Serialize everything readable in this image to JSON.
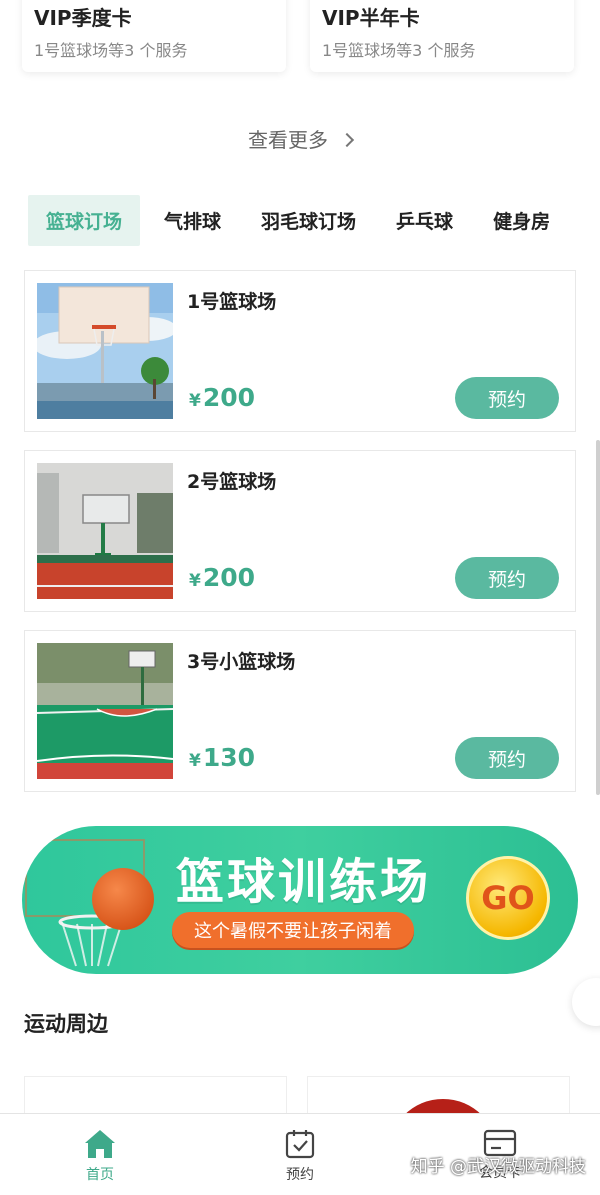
{
  "vip_cards": [
    {
      "title": "VIP季度卡",
      "subtitle": "1号篮球场等3 个服务"
    },
    {
      "title": "VIP半年卡",
      "subtitle": "1号篮球场等3 个服务"
    }
  ],
  "more_label": "查看更多",
  "tabs": [
    "篮球订场",
    "气排球",
    "羽毛球订场",
    "乒乓球",
    "健身房"
  ],
  "venues": [
    {
      "name": "1号篮球场",
      "currency": "¥",
      "price": "200",
      "book_label": "预约"
    },
    {
      "name": "2号篮球场",
      "currency": "¥",
      "price": "200",
      "book_label": "预约"
    },
    {
      "name": "3号小篮球场",
      "currency": "¥",
      "price": "130",
      "book_label": "预约"
    }
  ],
  "banner": {
    "title": "篮球训练场",
    "subtitle": "这个暑假不要让孩子闲着",
    "go_label": "GO"
  },
  "section_title": "运动周边",
  "nav": [
    {
      "label": "首页",
      "icon": "home-icon"
    },
    {
      "label": "预约",
      "icon": "calendar-check-icon"
    },
    {
      "label": "会员卡",
      "icon": "card-icon"
    }
  ],
  "watermark": "知乎 @武汉微驱动科技",
  "colors": {
    "accent": "#3ea98a",
    "button": "#5ab9a0",
    "tab_active_bg": "#e6f3ef",
    "banner_green": "#2fc79c",
    "banner_pill": "#f06f2c"
  }
}
